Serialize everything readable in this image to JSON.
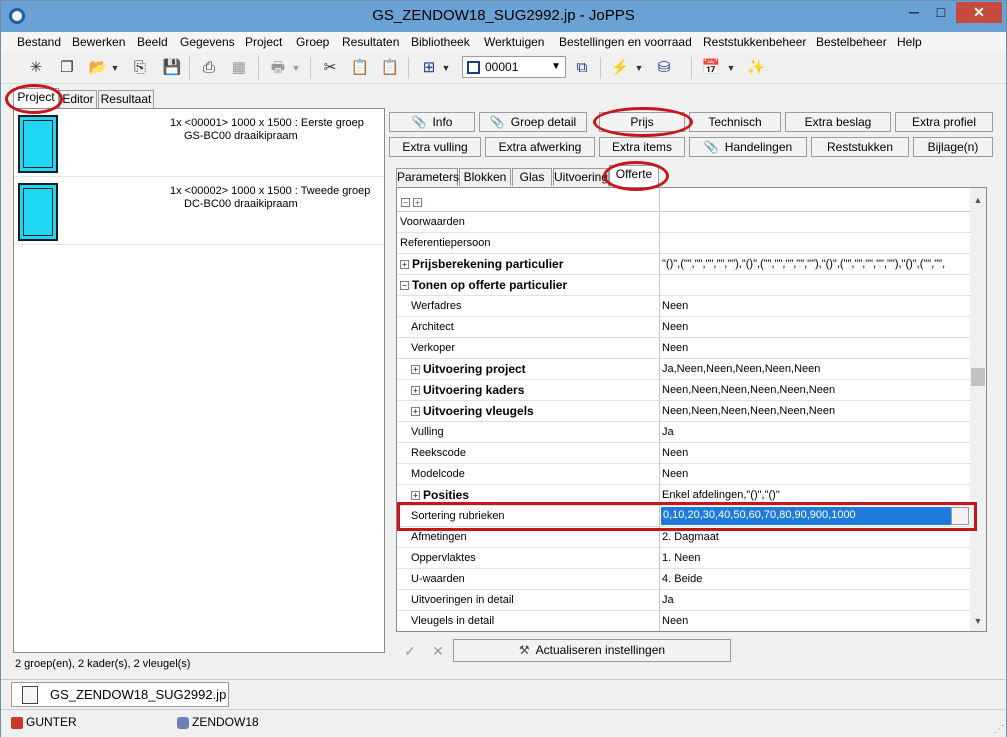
{
  "window": {
    "title": "GS_ZENDOW18_SUG2992.jp - JoPPS",
    "min": "─",
    "max": "□",
    "close": "✕"
  },
  "menu": [
    "Bestand",
    "Bewerken",
    "Beeld",
    "Gegevens",
    "Project",
    "Groep",
    "Resultaten",
    "Bibliotheek",
    "Werktuigen",
    "Bestellingen en voorraad",
    "Reststukkenbeheer",
    "Bestelbeheer",
    "Help"
  ],
  "toolbar": {
    "combo_value": "00001"
  },
  "left_tabs": [
    "Project",
    "Editor",
    "Resultaat"
  ],
  "groups": [
    {
      "line1": "1x <00001> 1000 x 1500 : Eerste groep",
      "line2": "GS-BC00 draaikipraam"
    },
    {
      "line1": "1x <00002> 1000 x 1500 : Tweede groep",
      "line2": "DC-BC00 draaikipraam"
    }
  ],
  "left_status": "2 groep(en), 2 kader(s), 2 vleugel(s)",
  "buttons_row1": [
    "Info",
    "Groep detail",
    "Prijs",
    "Technisch",
    "Extra beslag",
    "Extra profiel"
  ],
  "buttons_row2": [
    "Extra vulling",
    "Extra afwerking",
    "Extra items",
    "Handelingen",
    "Reststukken",
    "Bijlage(n)"
  ],
  "right_tabs": [
    "Parameters",
    "Blokken",
    "Glas",
    "Uitvoering",
    "Offerte"
  ],
  "grid_rows": [
    {
      "name": "Voorwaarden",
      "value": "",
      "indent": false,
      "bold": false,
      "expander": ""
    },
    {
      "name": "Referentiepersoon",
      "value": "",
      "indent": false,
      "bold": false,
      "expander": ""
    },
    {
      "name": "Prijsberekening particulier",
      "value": "\"()\",(\"\",\"\",\"\",\"\",\"\"),\"()\",(\"\",\"\",\"\",\"\",\"\"),\"()\",(\"\",\"\",\"\",\"\",\"\"),\"()\",(\"\",\"\",",
      "indent": false,
      "bold": true,
      "expander": "+"
    },
    {
      "name": "Tonen op offerte particulier",
      "value": "",
      "indent": false,
      "bold": true,
      "expander": "−"
    },
    {
      "name": "Werfadres",
      "value": "Neen",
      "indent": true,
      "bold": false,
      "expander": ""
    },
    {
      "name": "Architect",
      "value": "Neen",
      "indent": true,
      "bold": false,
      "expander": ""
    },
    {
      "name": "Verkoper",
      "value": "Neen",
      "indent": true,
      "bold": false,
      "expander": ""
    },
    {
      "name": "Uitvoering project",
      "value": "Ja,Neen,Neen,Neen,Neen,Neen",
      "indent": true,
      "bold": true,
      "expander": "+"
    },
    {
      "name": "Uitvoering kaders",
      "value": "Neen,Neen,Neen,Neen,Neen,Neen",
      "indent": true,
      "bold": true,
      "expander": "+"
    },
    {
      "name": "Uitvoering vleugels",
      "value": "Neen,Neen,Neen,Neen,Neen,Neen",
      "indent": true,
      "bold": true,
      "expander": "+"
    },
    {
      "name": "Vulling",
      "value": "Ja",
      "indent": true,
      "bold": false,
      "expander": ""
    },
    {
      "name": "Reekscode",
      "value": "Neen",
      "indent": true,
      "bold": false,
      "expander": ""
    },
    {
      "name": "Modelcode",
      "value": "Neen",
      "indent": true,
      "bold": false,
      "expander": ""
    },
    {
      "name": "Posities",
      "value": "Enkel afdelingen,\"()\",\"()\"",
      "indent": true,
      "bold": true,
      "expander": "+"
    },
    {
      "name": "Sortering rubrieken",
      "value": "0,10,20,30,40,50,60,70,80,90,900,1000",
      "indent": true,
      "bold": false,
      "expander": "",
      "selected": true
    },
    {
      "name": "Afmetingen",
      "value": "2. Dagmaat",
      "indent": true,
      "bold": false,
      "expander": ""
    },
    {
      "name": "Oppervlaktes",
      "value": "1. Neen",
      "indent": true,
      "bold": false,
      "expander": ""
    },
    {
      "name": "U-waarden",
      "value": "4. Beide",
      "indent": true,
      "bold": false,
      "expander": ""
    },
    {
      "name": "Uitvoeringen in detail",
      "value": "Ja",
      "indent": true,
      "bold": false,
      "expander": ""
    },
    {
      "name": "Vleugels in detail",
      "value": "Neen",
      "indent": true,
      "bold": false,
      "expander": ""
    }
  ],
  "actions": {
    "ok": "✓",
    "cancel": "✕",
    "refresh_label": "Actualiseren instellingen"
  },
  "document_tab": "GS_ZENDOW18_SUG2992.jp",
  "status": {
    "user": "GUNTER",
    "database": "ZENDOW18"
  },
  "colors": {
    "titlebar": "#6aa2d6",
    "selection": "#1e7bdc",
    "annotation": "#c4161c",
    "glass": "#1fd7f2"
  }
}
